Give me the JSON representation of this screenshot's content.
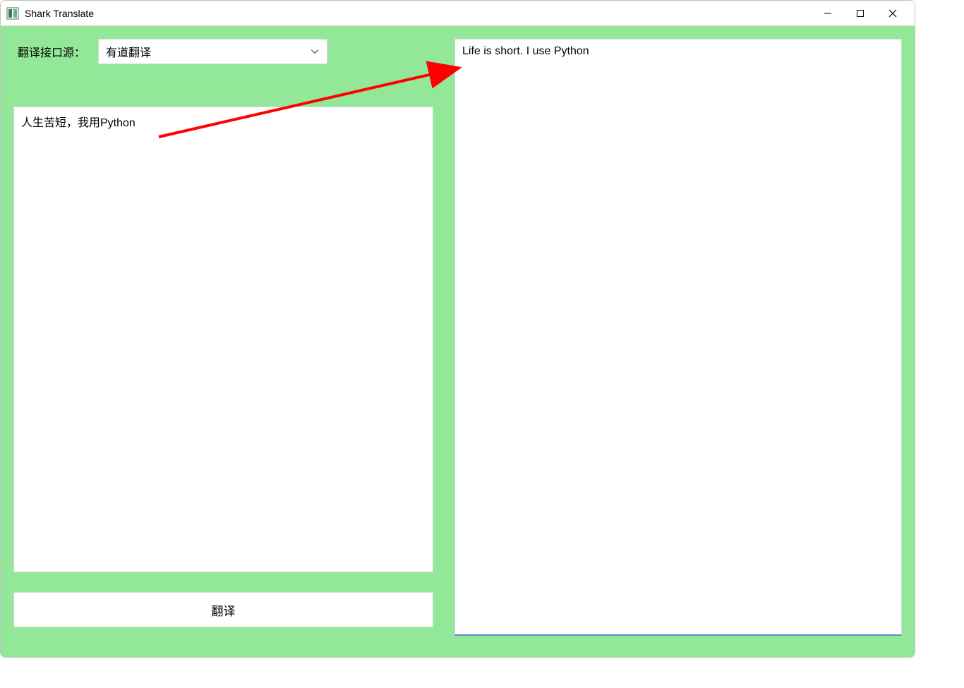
{
  "window": {
    "title": "Shark Translate"
  },
  "source": {
    "label": "翻译接口源：",
    "selected": "有道翻译"
  },
  "input": {
    "text": "人生苦短，我用Python"
  },
  "output": {
    "text": "Life is short. I use Python"
  },
  "action": {
    "translate_label": "翻译"
  }
}
